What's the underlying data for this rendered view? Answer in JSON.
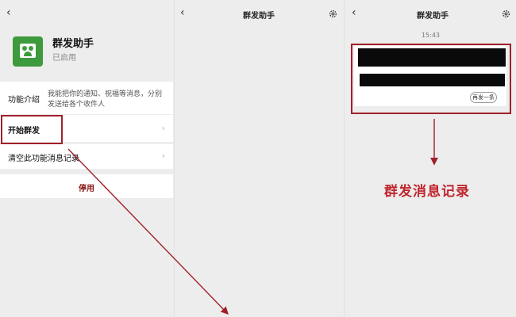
{
  "left_panel": {
    "back_glyph": "‹",
    "app_name": "群发助手",
    "app_status": "已启用",
    "intro_label": "功能介绍",
    "intro_text": "我能把你的通知、祝福等消息，分别发送给各个收件人",
    "start_label": "开始群发",
    "clear_label": "清空此功能消息记录",
    "disable_label": "停用",
    "chevron": "›"
  },
  "middle_panel": {
    "back_glyph": "‹",
    "title": "群发助手"
  },
  "right_panel": {
    "back_glyph": "‹",
    "title": "群发助手",
    "time": "15:43",
    "resend_label": "再发一条"
  },
  "annotation": {
    "label": "群发消息记录",
    "color": "#c0262d"
  },
  "icons": [
    "back-arrow-icon",
    "settings-gear-icon",
    "group-send-app-icon",
    "chevron-right-icon"
  ]
}
